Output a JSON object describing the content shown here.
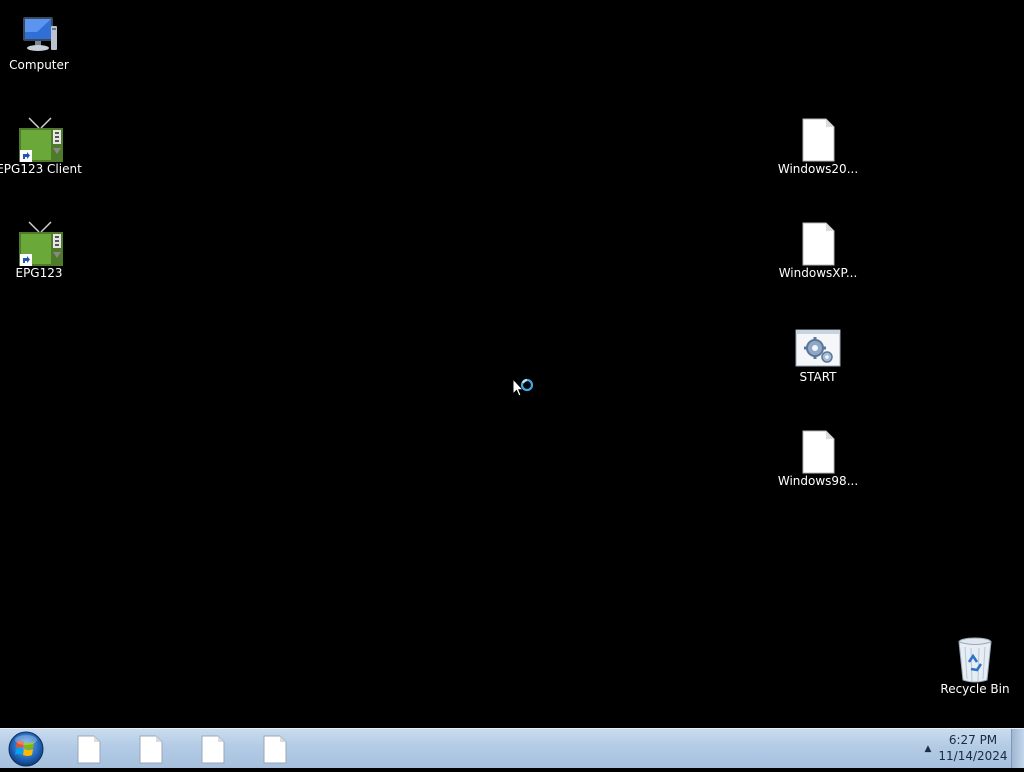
{
  "desktop": {
    "icons": [
      {
        "label": "Computer",
        "icon": "computer-icon"
      },
      {
        "label": "EPG123 Client",
        "icon": "tv-shortcut-icon"
      },
      {
        "label": "EPG123",
        "icon": "tv-shortcut-icon"
      },
      {
        "label": "Windows20...",
        "icon": "blank-file-icon"
      },
      {
        "label": "WindowsXP...",
        "icon": "blank-file-icon"
      },
      {
        "label": "START",
        "icon": "batch-file-icon"
      },
      {
        "label": "Windows98...",
        "icon": "blank-file-icon"
      },
      {
        "label": "Recycle Bin",
        "icon": "recycle-bin-icon"
      }
    ],
    "background_color": "#000000"
  },
  "taskbar": {
    "start_button": "windows-orb-icon",
    "task_buttons": [
      "blank-file-icon",
      "blank-file-icon",
      "blank-file-icon",
      "blank-file-icon"
    ],
    "tray_arrow": "▲",
    "clock": {
      "time": "6:27 PM",
      "date": "11/14/2024"
    }
  },
  "cursor": "busy-arrow-cursor"
}
